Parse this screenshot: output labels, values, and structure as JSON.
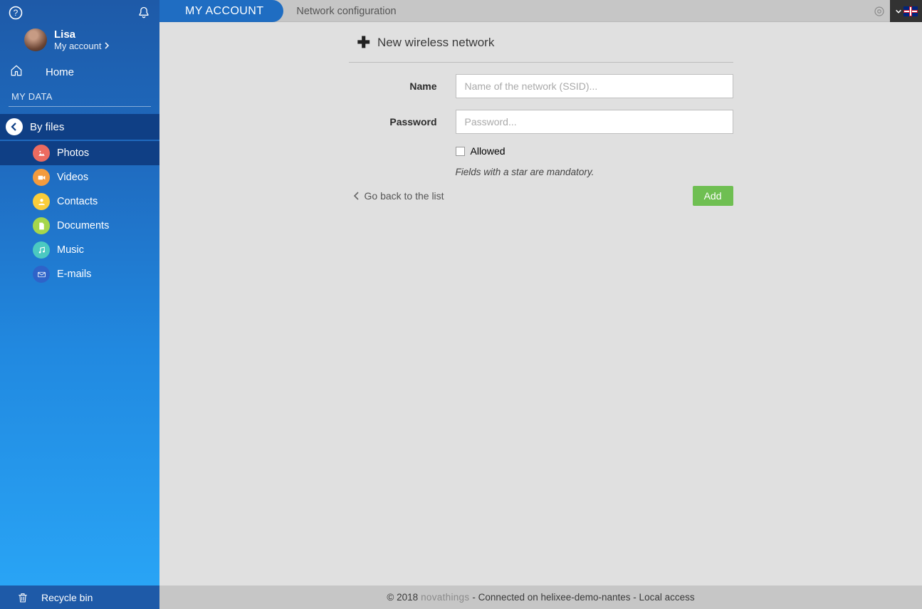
{
  "user": {
    "name": "Lisa",
    "subLabel": "My account"
  },
  "sidebar": {
    "home": "Home",
    "sectionMyData": "MY DATA",
    "byFiles": "By files",
    "categories": {
      "photos": "Photos",
      "videos": "Videos",
      "contacts": "Contacts",
      "documents": "Documents",
      "music": "Music",
      "emails": "E-mails"
    },
    "recycleBin": "Recycle bin"
  },
  "header": {
    "accountTab": "MY ACCOUNT",
    "breadcrumb": "Network configuration"
  },
  "form": {
    "heading": "New wireless network",
    "nameLabel": "Name",
    "namePlaceholder": "Name of the network (SSID)...",
    "passwordLabel": "Password",
    "passwordPlaceholder": "Password...",
    "allowedLabel": "Allowed",
    "mandatoryNote": "Fields with a star are mandatory.",
    "goBack": "Go back to the list",
    "addButton": "Add"
  },
  "footer": {
    "copyright": "© 2018",
    "brand": "novathings",
    "connection": " - Connected on helixee-demo-nantes - Local access"
  }
}
